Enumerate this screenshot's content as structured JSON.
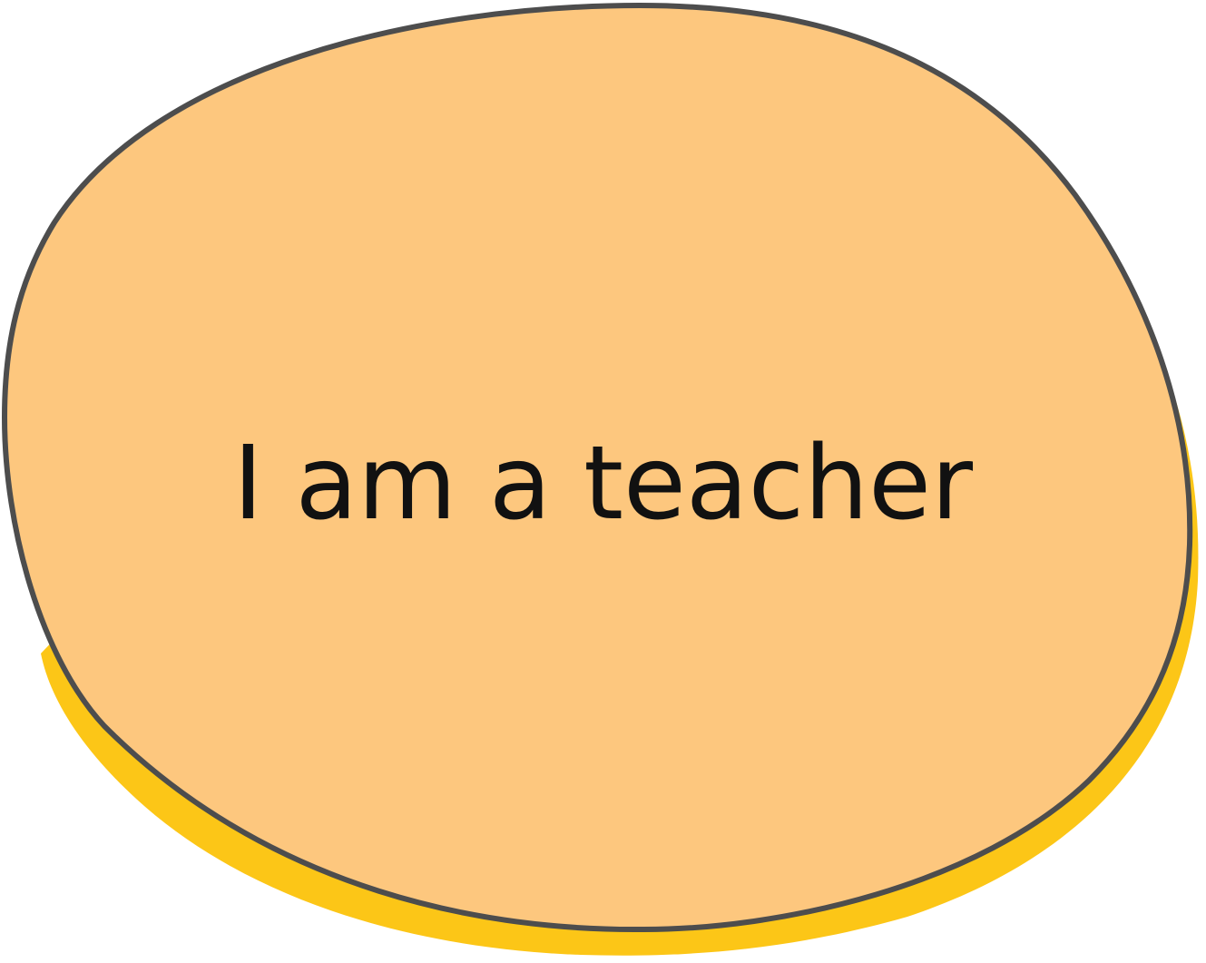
{
  "card": {
    "text": "I am a teacher"
  },
  "colors": {
    "fill": "#FDC77E",
    "shadow": "#FCC617",
    "outline": "#4D4D4D",
    "text": "#111111"
  }
}
